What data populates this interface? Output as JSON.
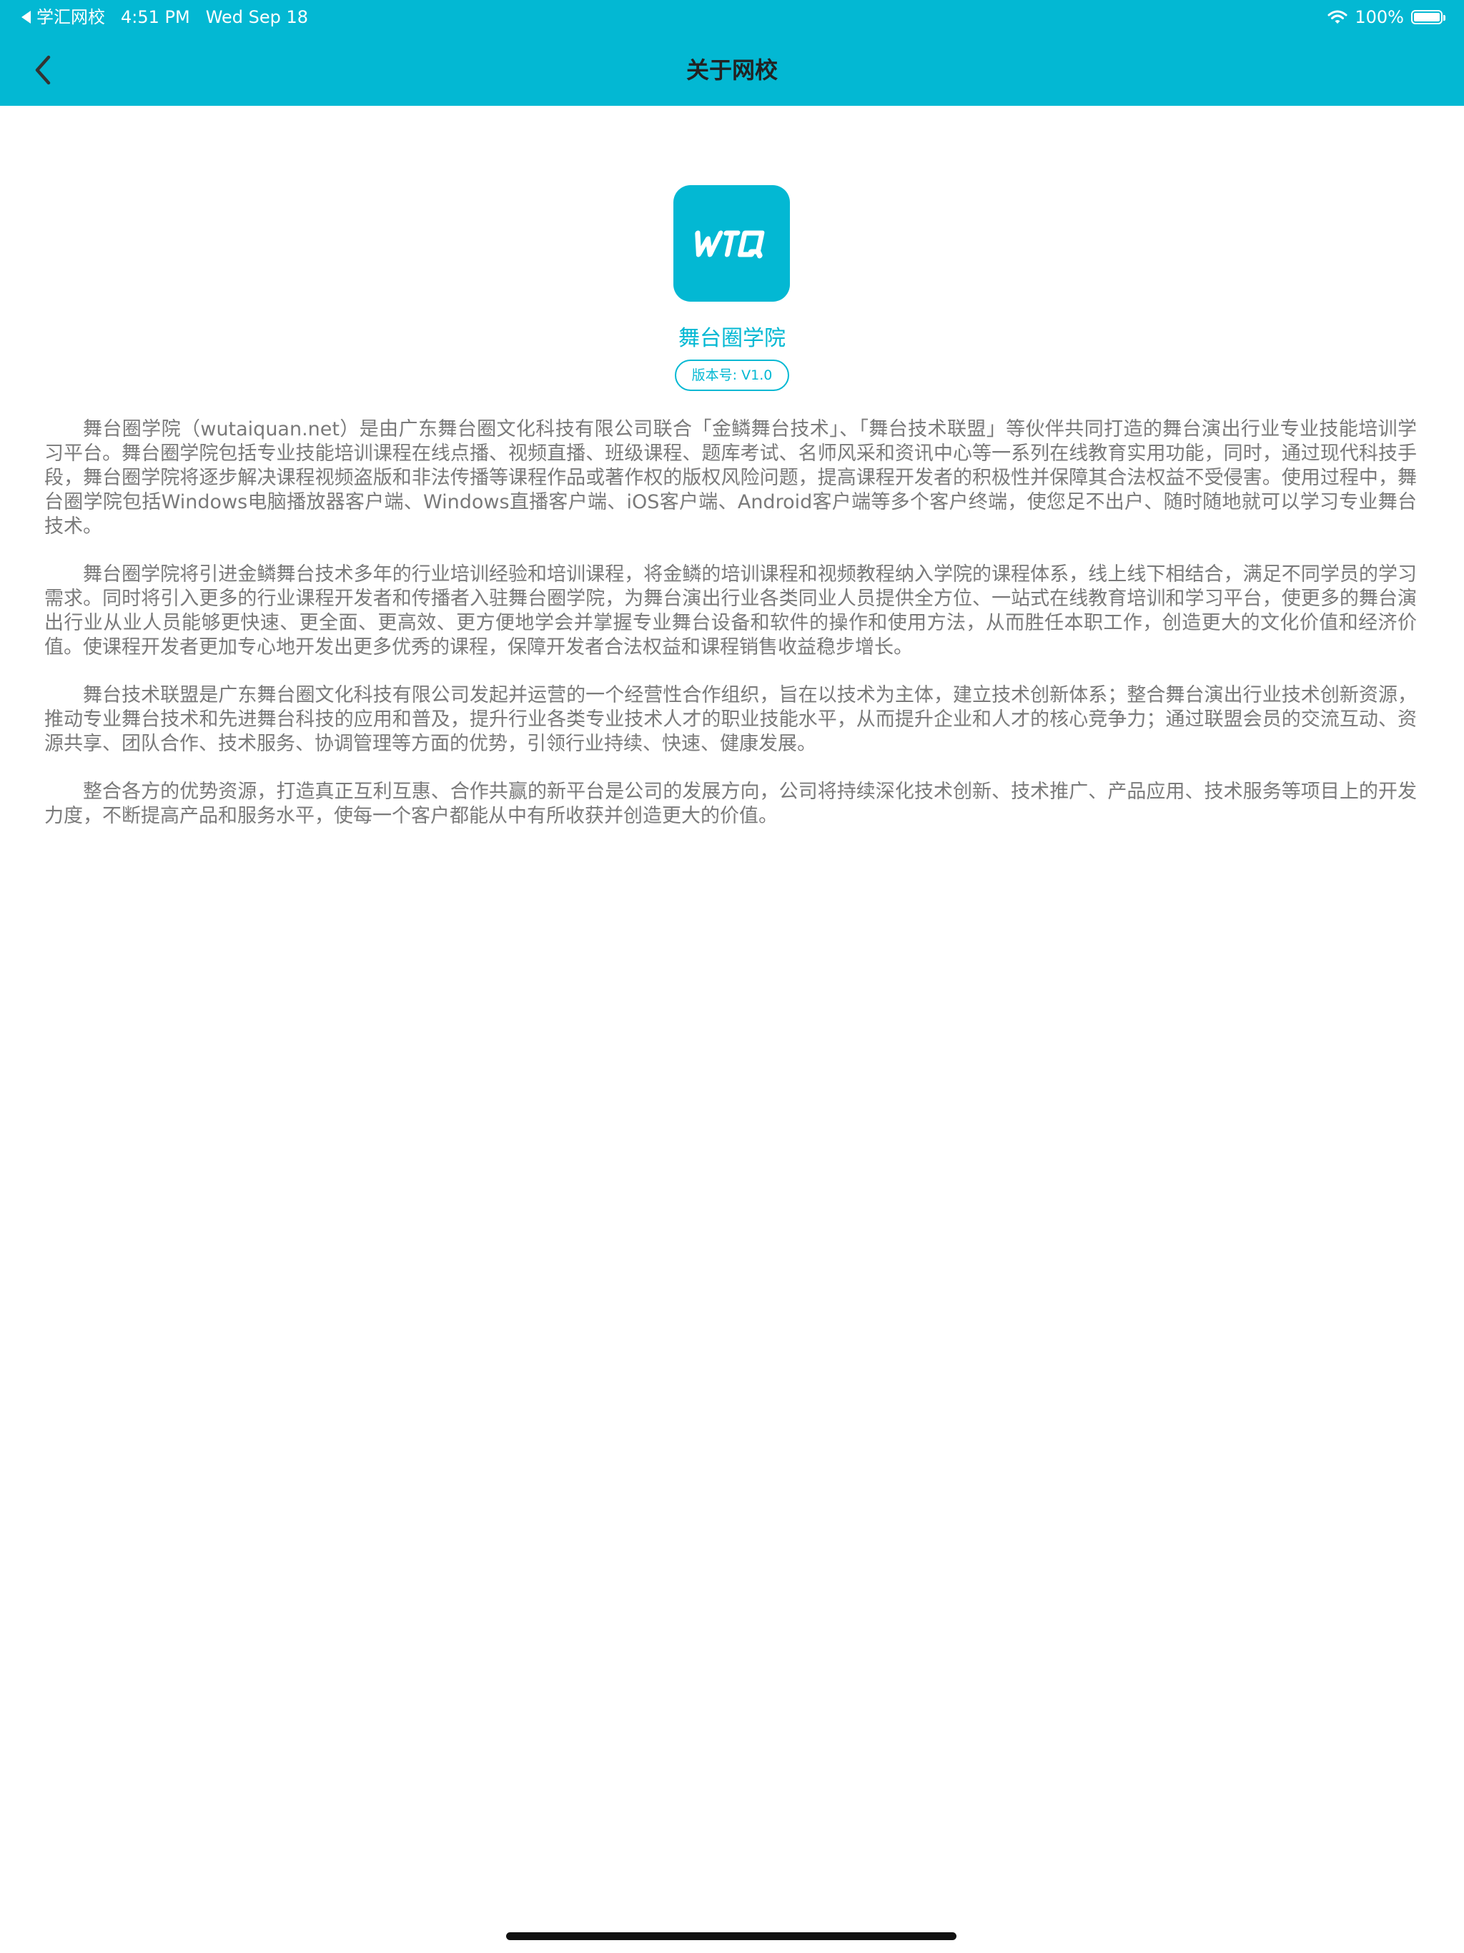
{
  "status_bar": {
    "back_app": "学汇网校",
    "time": "4:51 PM",
    "date": "Wed Sep 18",
    "battery": "100%"
  },
  "nav": {
    "back_icon": "chevron-left-icon",
    "title": "关于网校"
  },
  "app": {
    "logo_text": "WTQ",
    "name": "舞台圈学院",
    "version": "版本号: V1.0"
  },
  "colors": {
    "accent": "#03b8d3",
    "body_text": "#7a7a7a",
    "title_text": "#222222"
  },
  "article": {
    "paragraphs": [
      "舞台圈学院（wutaiquan.net）是由广东舞台圈文化科技有限公司联合「金鳞舞台技术」、「舞台技术联盟」等伙伴共同打造的舞台演出行业专业技能培训学习平台。舞台圈学院包括专业技能培训课程在线点播、视频直播、班级课程、题库考试、名师风采和资讯中心等一系列在线教育实用功能，同时，通过现代科技手段，舞台圈学院将逐步解决课程视频盗版和非法传播等课程作品或著作权的版权风险问题，提高课程开发者的积极性并保障其合法权益不受侵害。使用过程中，舞台圈学院包括Windows电脑播放器客户端、Windows直播客户端、iOS客户端、Android客户端等多个客户终端，使您足不出户、随时随地就可以学习专业舞台技术。",
      "舞台圈学院将引进金鳞舞台技术多年的行业培训经验和培训课程，将金鳞的培训课程和视频教程纳入学院的课程体系，线上线下相结合，满足不同学员的学习需求。同时将引入更多的行业课程开发者和传播者入驻舞台圈学院，为舞台演出行业各类同业人员提供全方位、一站式在线教育培训和学习平台，使更多的舞台演出行业从业人员能够更快速、更全面、更高效、更方便地学会并掌握专业舞台设备和软件的操作和使用方法，从而胜任本职工作，创造更大的文化价值和经济价值。使课程开发者更加专心地开发出更多优秀的课程，保障开发者合法权益和课程销售收益稳步增长。",
      "舞台技术联盟是广东舞台圈文化科技有限公司发起并运营的一个经营性合作组织，旨在以技术为主体，建立技术创新体系；整合舞台演出行业技术创新资源，推动专业舞台技术和先进舞台科技的应用和普及，提升行业各类专业技术人才的职业技能水平，从而提升企业和人才的核心竞争力；通过联盟会员的交流互动、资源共享、团队合作、技术服务、协调管理等方面的优势，引领行业持续、快速、健康发展。",
      "整合各方的优势资源，打造真正互利互惠、合作共赢的新平台是公司的发展方向，公司将持续深化技术创新、技术推广、产品应用、技术服务等项目上的开发力度，不断提高产品和服务水平，使每一个客户都能从中有所收获并创造更大的价值。"
    ]
  }
}
